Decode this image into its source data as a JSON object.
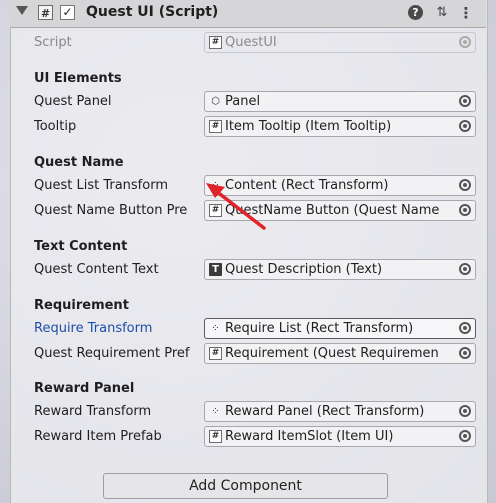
{
  "header": {
    "title": "Quest UI (Script)",
    "script_icon_glyph": "#",
    "checkbox_glyph": "✓",
    "help_glyph": "?",
    "sliders_glyph": "⇅",
    "menu_glyph": "⋮"
  },
  "fields": {
    "script": {
      "label": "Script",
      "value": "QuestUI"
    },
    "quest_panel": {
      "label": "Quest Panel",
      "value": "Panel"
    },
    "tooltip": {
      "label": "Tooltip",
      "value": "Item Tooltip (Item Tooltip)"
    },
    "quest_list_transform": {
      "label": "Quest List Transform",
      "value": "Content (Rect Transform)"
    },
    "quest_name_button_prefab": {
      "label": "Quest Name Button Pre",
      "value": "QuestName Button (Quest Name"
    },
    "quest_content_text": {
      "label": "Quest Content Text",
      "value": "Quest Description (Text)"
    },
    "require_transform": {
      "label": "Require Transform",
      "value": "Require List (Rect Transform)"
    },
    "quest_requirement_prefab": {
      "label": "Quest Requirement Pref",
      "value": "Requirement (Quest Requiremen"
    },
    "reward_transform": {
      "label": "Reward Transform",
      "value": "Reward Panel (Rect Transform)"
    },
    "reward_item_prefab": {
      "label": "Reward Item Prefab",
      "value": "Reward ItemSlot (Item UI)"
    }
  },
  "sections": {
    "ui_elements": "UI Elements",
    "quest_name": "Quest Name",
    "text_content": "Text Content",
    "requirement": "Requirement",
    "reward_panel": "Reward Panel"
  },
  "icons": {
    "hash": "#",
    "text": "T",
    "cube": "⬡",
    "rect": "⁘"
  },
  "add_component_label": "Add Component",
  "colors": {
    "label_blue": "#1e4fa8",
    "annotation_arrow": "#e0242a"
  }
}
